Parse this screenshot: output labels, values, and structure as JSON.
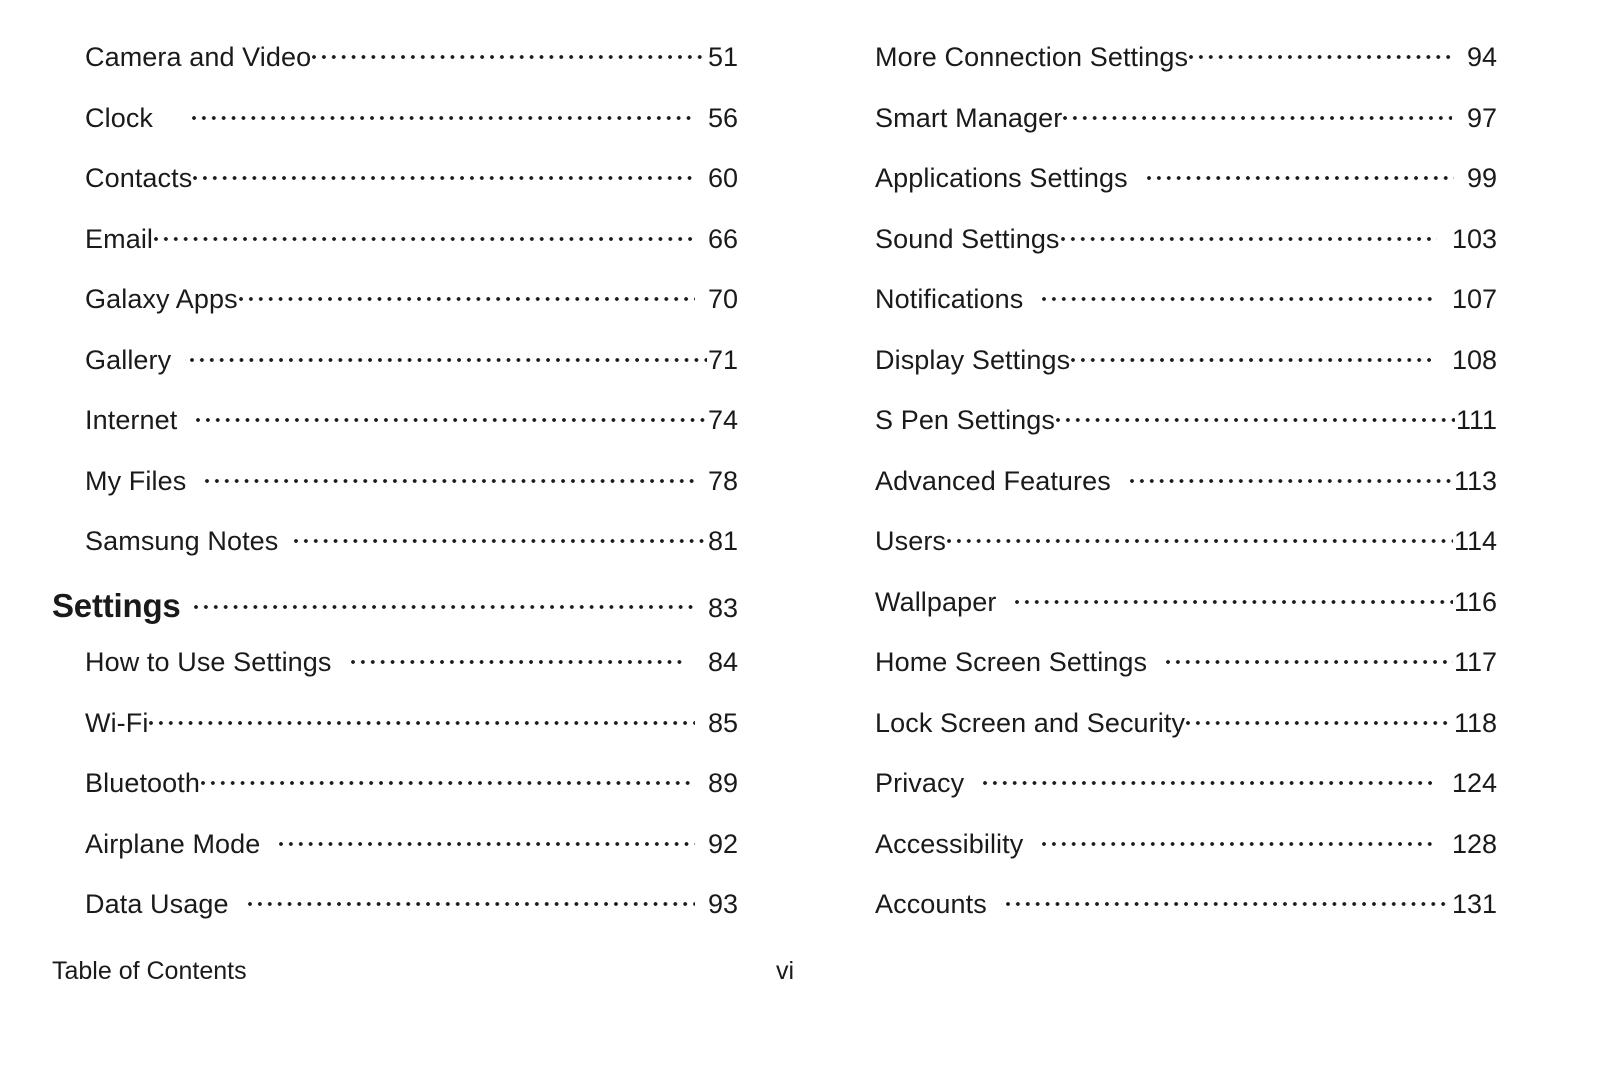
{
  "document": {
    "type": "table-of-contents",
    "background_color": "#ffffff",
    "text_color": "#1a1a1a"
  },
  "columns": {
    "left": {
      "entries": [
        {
          "label": "Camera and Video",
          "page": "51",
          "level": 2,
          "gap": 0,
          "tail": 0
        },
        {
          "label": "Clock",
          "page": "56",
          "level": 2,
          "gap": 38,
          "tail": 14
        },
        {
          "label": "Contacts",
          "page": "60",
          "level": 2,
          "gap": 0,
          "tail": 12
        },
        {
          "label": "Email",
          "page": "66",
          "level": 2,
          "gap": 0,
          "tail": 12
        },
        {
          "label": "Galaxy Apps",
          "page": "70",
          "level": 2,
          "gap": 0,
          "tail": 12
        },
        {
          "label": "Gallery",
          "page": "71",
          "level": 2,
          "gap": 18,
          "tail": 0
        },
        {
          "label": "Internet",
          "page": "74",
          "level": 2,
          "gap": 18,
          "tail": 0
        },
        {
          "label": "My Files",
          "page": "78",
          "level": 2,
          "gap": 18,
          "tail": 12
        },
        {
          "label": "Samsung Notes",
          "page": "81",
          "level": 2,
          "gap": 15,
          "tail": 0
        },
        {
          "label": "Settings",
          "page": "83",
          "level": 1,
          "gap": 12,
          "tail": 12
        },
        {
          "label": "How to Use Settings",
          "page": "84",
          "level": 2,
          "gap": 18,
          "tail": 20
        },
        {
          "label": "Wi-Fi",
          "page": "85",
          "level": 2,
          "gap": 0,
          "tail": 12
        },
        {
          "label": "Bluetooth",
          "page": "89",
          "level": 2,
          "gap": 0,
          "tail": 12
        },
        {
          "label": "Airplane Mode",
          "page": "92",
          "level": 2,
          "gap": 18,
          "tail": 12
        },
        {
          "label": "Data Usage",
          "page": "93",
          "level": 2,
          "gap": 18,
          "tail": 12
        }
      ]
    },
    "right": {
      "entries": [
        {
          "label": "More Connection Settings",
          "page": "94",
          "level": 2,
          "gap": 0,
          "tail": 12
        },
        {
          "label": "Smart Manager",
          "page": "97",
          "level": 2,
          "gap": 0,
          "tail": 14
        },
        {
          "label": "Applications Settings",
          "page": "99",
          "level": 2,
          "gap": 18,
          "tail": 12
        },
        {
          "label": "Sound Settings",
          "page": "103",
          "level": 2,
          "gap": 0,
          "tail": 14
        },
        {
          "label": "Notifications",
          "page": "107",
          "level": 2,
          "gap": 18,
          "tail": 14
        },
        {
          "label": "Display Settings",
          "page": "108",
          "level": 2,
          "gap": 0,
          "tail": 14
        },
        {
          "label": "S Pen Settings",
          "page": "111",
          "level": 2,
          "gap": 0,
          "tail": 0
        },
        {
          "label": "Advanced Features",
          "page": "113",
          "level": 2,
          "gap": 18,
          "tail": 0
        },
        {
          "label": "Users",
          "page": "114",
          "level": 2,
          "gap": 0,
          "tail": 0
        },
        {
          "label": "Wallpaper",
          "page": "116",
          "level": 2,
          "gap": 18,
          "tail": 0
        },
        {
          "label": "Home Screen Settings",
          "page": "117",
          "level": 2,
          "gap": 18,
          "tail": 0
        },
        {
          "label": "Lock Screen and Security",
          "page": "118",
          "level": 2,
          "gap": 0,
          "tail": 0
        },
        {
          "label": "Privacy",
          "page": "124",
          "level": 2,
          "gap": 18,
          "tail": 14
        },
        {
          "label": "Accessibility",
          "page": "128",
          "level": 2,
          "gap": 18,
          "tail": 14
        },
        {
          "label": "Accounts",
          "page": "131",
          "level": 2,
          "gap": 18,
          "tail": 0
        }
      ]
    }
  },
  "footer": {
    "section_title": "Table of Contents",
    "page_number": "vi"
  }
}
